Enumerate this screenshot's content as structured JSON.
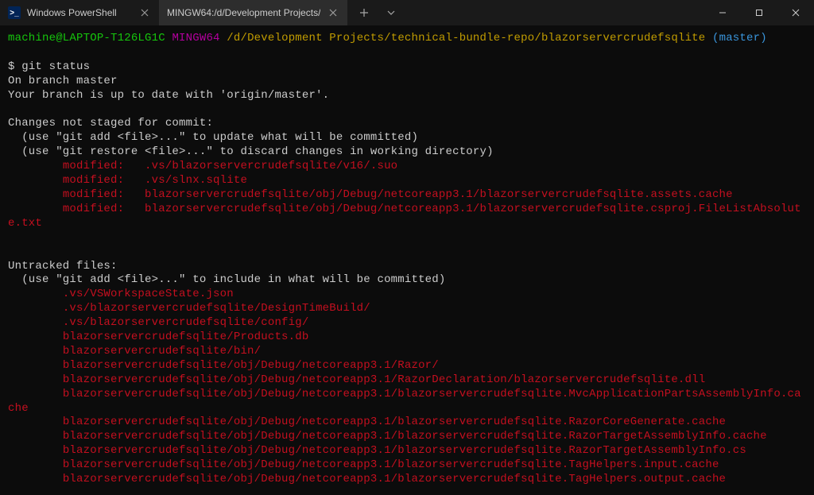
{
  "titlebar": {
    "tabs": [
      {
        "title": "Windows PowerShell",
        "active": false
      },
      {
        "title": "MINGW64:/d/Development Projects/",
        "active": true
      }
    ]
  },
  "prompt": {
    "user_host": "machine@LAPTOP-T126LG1C",
    "shell": "MINGW64",
    "cwd": "/d/Development Projects/technical-bundle-repo/blazorservercrudefsqlite",
    "branch": "(master)",
    "symbol": "$"
  },
  "command": "git status",
  "output": {
    "branch_line": "On branch master",
    "uptodate_line": "Your branch is up to date with 'origin/master'.",
    "changes_header": "Changes not staged for commit:",
    "hint_add": "  (use \"git add <file>...\" to update what will be committed)",
    "hint_restore": "  (use \"git restore <file>...\" to discard changes in working directory)",
    "modified": [
      "        modified:   .vs/blazorservercrudefsqlite/v16/.suo",
      "        modified:   .vs/slnx.sqlite",
      "        modified:   blazorservercrudefsqlite/obj/Debug/netcoreapp3.1/blazorservercrudefsqlite.assets.cache",
      "        modified:   blazorservercrudefsqlite/obj/Debug/netcoreapp3.1/blazorservercrudefsqlite.csproj.FileListAbsolute.txt"
    ],
    "untracked_header": "Untracked files:",
    "hint_include": "  (use \"git add <file>...\" to include in what will be committed)",
    "untracked": [
      "        .vs/VSWorkspaceState.json",
      "        .vs/blazorservercrudefsqlite/DesignTimeBuild/",
      "        .vs/blazorservercrudefsqlite/config/",
      "        blazorservercrudefsqlite/Products.db",
      "        blazorservercrudefsqlite/bin/",
      "        blazorservercrudefsqlite/obj/Debug/netcoreapp3.1/Razor/",
      "        blazorservercrudefsqlite/obj/Debug/netcoreapp3.1/RazorDeclaration/blazorservercrudefsqlite.dll",
      "        blazorservercrudefsqlite/obj/Debug/netcoreapp3.1/blazorservercrudefsqlite.MvcApplicationPartsAssemblyInfo.cache",
      "        blazorservercrudefsqlite/obj/Debug/netcoreapp3.1/blazorservercrudefsqlite.RazorCoreGenerate.cache",
      "        blazorservercrudefsqlite/obj/Debug/netcoreapp3.1/blazorservercrudefsqlite.RazorTargetAssemblyInfo.cache",
      "        blazorservercrudefsqlite/obj/Debug/netcoreapp3.1/blazorservercrudefsqlite.RazorTargetAssemblyInfo.cs",
      "        blazorservercrudefsqlite/obj/Debug/netcoreapp3.1/blazorservercrudefsqlite.TagHelpers.input.cache",
      "        blazorservercrudefsqlite/obj/Debug/netcoreapp3.1/blazorservercrudefsqlite.TagHelpers.output.cache"
    ]
  }
}
